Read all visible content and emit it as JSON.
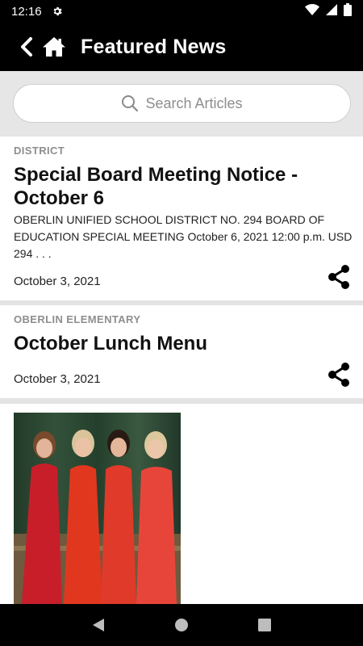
{
  "status_bar": {
    "time": "12:16"
  },
  "app_bar": {
    "title": "Featured News"
  },
  "search": {
    "placeholder": "Search Articles"
  },
  "articles": [
    {
      "category": "DISTRICT",
      "title": "Special Board Meeting Notice - October 6",
      "excerpt": "OBERLIN UNIFIED SCHOOL DISTRICT NO. 294 BOARD OF EDUCATION SPECIAL MEETING October 6, 2021 12:00 p.m. USD 294 . . .",
      "date": "October 3, 2021"
    },
    {
      "category": "OBERLIN ELEMENTARY",
      "title": "October Lunch Menu",
      "date": "October 3, 2021"
    }
  ],
  "colors": {
    "bar": "#000000",
    "category": "#8e8e8e",
    "divider": "#e3e3e3"
  }
}
